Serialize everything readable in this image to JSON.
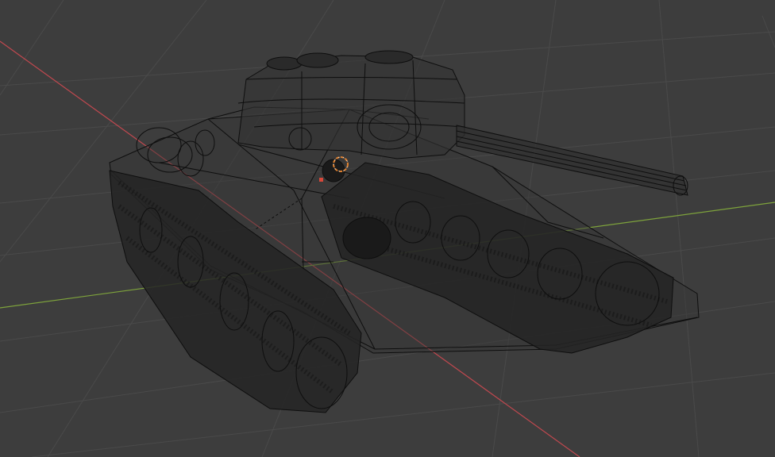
{
  "viewport": {
    "mode": "wireframe",
    "background_color": "#3d3d3d",
    "grid_color": "#4a4a4a",
    "x_axis_color": "#c0484f",
    "y_axis_color": "#7ea33c",
    "wire_color": "#0e0e0e",
    "cursor_color": "#e0802e",
    "object_origin_color": "#d8483a"
  },
  "scene": {
    "object": "tank",
    "parts": [
      "hull",
      "turret",
      "gun-barrel",
      "left-track",
      "right-track",
      "road-wheels",
      "rear-fuel-drums"
    ]
  }
}
